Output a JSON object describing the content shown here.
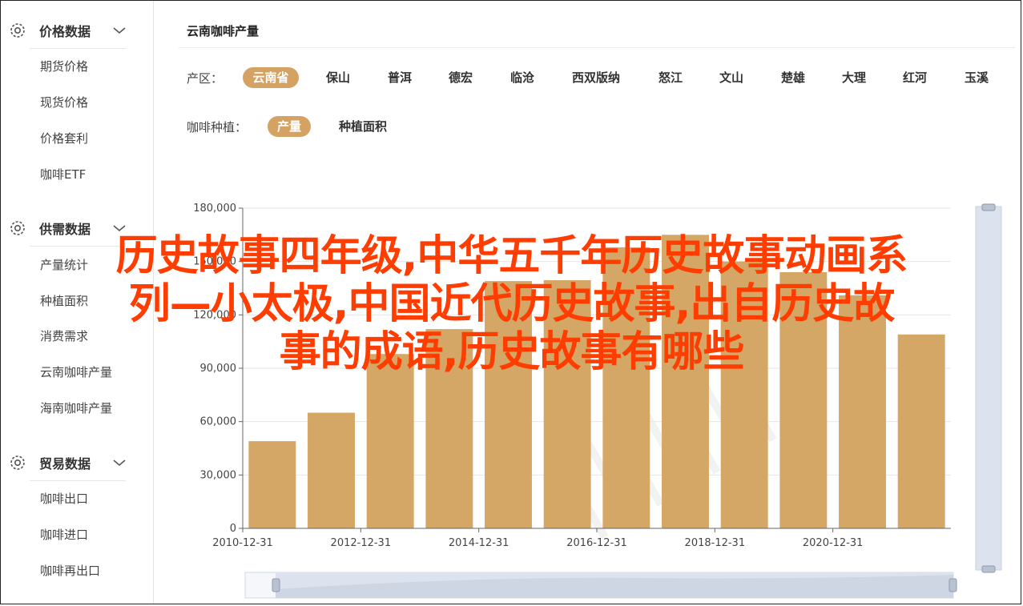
{
  "sidebar": {
    "groups": [
      {
        "title": "价格数据",
        "items": [
          "期货价格",
          "现货价格",
          "价格套利",
          "咖啡ETF"
        ]
      },
      {
        "title": "供需数据",
        "items": [
          "产量统计",
          "种植面积",
          "消费需求",
          "云南咖啡产量",
          "海南咖啡产量"
        ]
      },
      {
        "title": "贸易数据",
        "items": [
          "咖啡出口",
          "咖啡进口",
          "咖啡再出口"
        ]
      }
    ]
  },
  "main": {
    "title": "云南咖啡产量",
    "region_label": "产区：",
    "regions": [
      "云南省",
      "保山",
      "普洱",
      "德宏",
      "临沧",
      "西双版纳",
      "怒江",
      "文山",
      "楚雄",
      "大理",
      "红河",
      "玉溪"
    ],
    "selected_region": "云南省",
    "metric_label": "咖啡种植：",
    "metrics": [
      "产量",
      "种植面积"
    ],
    "selected_metric": "产量"
  },
  "overlay": {
    "lines": [
      "历史故事四年级,中华五千年历史故事动画系",
      "列—小太极,中国近代历史故事,出自历史故",
      "事的成语,历史故事有哪些"
    ]
  },
  "colors": {
    "accent": "#d4a363",
    "bar": "#d4a767",
    "headline": "#ff3d00"
  },
  "chart_data": {
    "type": "bar",
    "categories": [
      "2010",
      "2011",
      "2012",
      "2013",
      "2014",
      "2015",
      "2016",
      "2017",
      "2018",
      "2019",
      "2020",
      "2021"
    ],
    "x_tick_labels": [
      "2010-12-31",
      "2012-12-31",
      "2014-12-31",
      "2016-12-31",
      "2018-12-31",
      "2020-12-31"
    ],
    "values": [
      49000,
      65000,
      98000,
      112000,
      139000,
      139500,
      158000,
      165000,
      150000,
      144000,
      131000,
      109000
    ],
    "ylim": [
      0,
      180000
    ],
    "y_ticks": [
      "0",
      "30,000",
      "60,000",
      "90,000",
      "120,000",
      "150,000",
      "180,000"
    ],
    "grid": true
  }
}
